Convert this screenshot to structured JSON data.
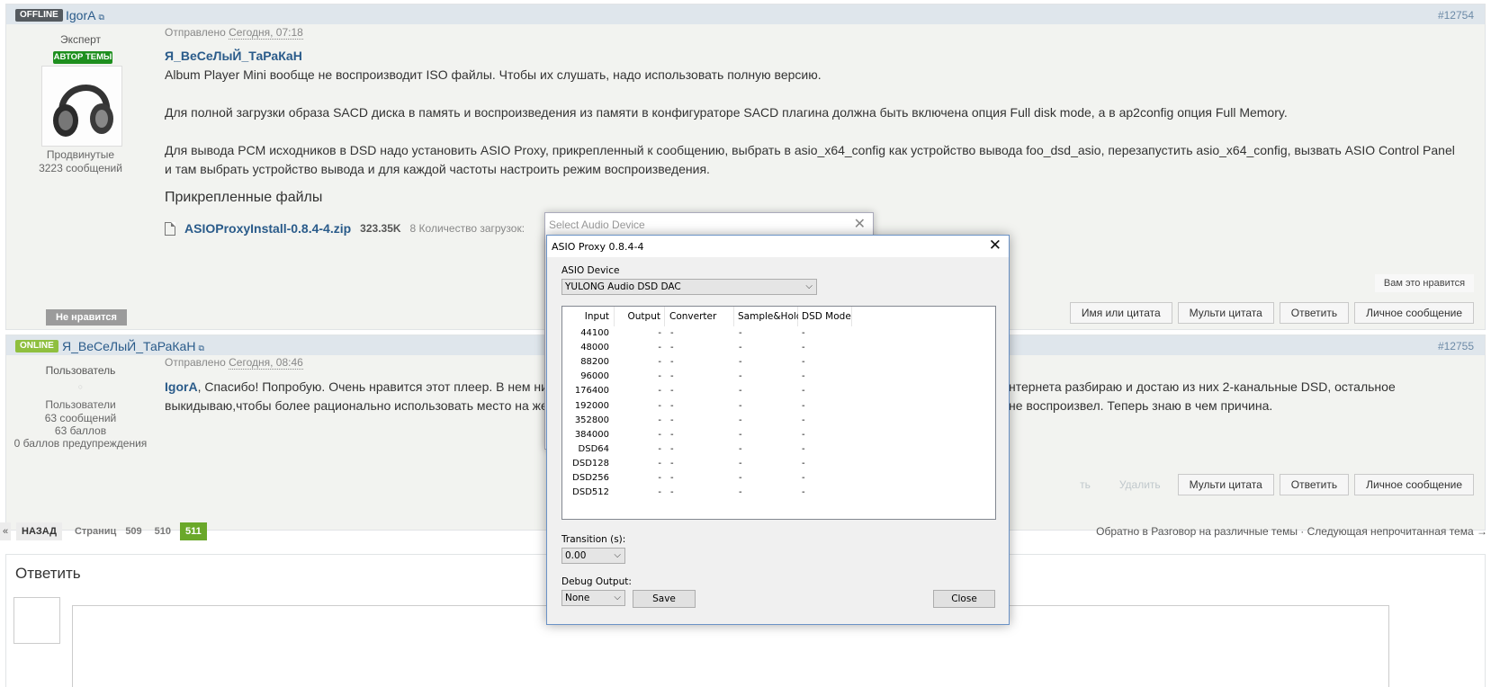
{
  "post1": {
    "status": "OFFLINE",
    "author": "IgorA",
    "number": "#12754",
    "rank": "Эксперт",
    "author_badge": "АВТОР ТЕМЫ",
    "group": "Продвинутые",
    "messages": "3223 сообщений",
    "sent_label": "Отправлено",
    "sent_time": "Сегодня, 07:18",
    "quote_author": "Я_ВеСеЛыЙ_ТаРаКаН",
    "p1": "Album Player Mini вообще не воспроизводит ISO файлы.  Чтобы их слушать, надо использовать полную версию.",
    "p2": "Для полной загрузки образа SACD диска в память и воспроизведения из памяти в конфигураторе SACD плагина должна быть включена опция Full disk mode, а в ap2config опция Full Memory.",
    "p3a": "Для вывода PCM исходников в DSD надо установить ASIO Proxy, прикрепленный к сообщению, выбрать в asio_x64_config как устройство вывода foo_dsd_asio, перезапустить asio_x64_config, вызвать ASIO Control Panel",
    "p3b": "и там выбрать устройство вывода и для каждой частоты настроить режим воспроизведения.",
    "attach_title": "Прикрепленные файлы",
    "file_name": "ASIOProxyInstall-0.8.4-4.zip",
    "file_size": "323.35K",
    "file_downloads": "8 Количество загрузок:",
    "like_text": "Вам это нравится",
    "dislike": "Не нравится",
    "buttons": [
      "Имя или цитата",
      "Мульти цитата",
      "Ответить",
      "Личное сообщение"
    ]
  },
  "post2": {
    "status": "ONLINE",
    "author": "Я_ВеСеЛыЙ_ТаРаКаН",
    "number": "#12755",
    "rank": "Пользователь",
    "group": "Пользователи",
    "messages": "63 сообщений",
    "points": "63 баллов",
    "warnings": "0 баллов предупреждения",
    "sent_label": "Отправлено",
    "sent_time": "Сегодня, 08:46",
    "reply_to": "IgorA",
    "l1_left": ", Спасибо! Попробую. Очень нравится этот плеер. В нем ничего",
    "l1_right": "нтернета разбираю и достаю из них 2-канальные DSD, остальное",
    "l2_left": "выкидываю,чтобы более рационально использовать место на жестк",
    "l2_right": "не воспроизвел. Теперь знаю в чем причина.",
    "muted_buttons": [
      "ть",
      "Удалить"
    ],
    "buttons": [
      "Мульти цитата",
      "Ответить",
      "Личное сообщение"
    ]
  },
  "pager": {
    "prev_arrow": "«",
    "back": "НАЗАД",
    "label": "Страниц",
    "pages": [
      "509",
      "510"
    ],
    "current": "511"
  },
  "nav": "Обратно в Разговор на различные темы · Следующая непрочитанная тема →",
  "reply": {
    "title": "Ответить"
  },
  "dialog_back": {
    "title": "Select Audio Device",
    "close": "✕"
  },
  "dialog": {
    "title": "ASIO Proxy 0.8.4-4",
    "close": "✕",
    "device_label": "ASIO Device",
    "device_value": "YULONG Audio DSD DAC",
    "columns": [
      "Input",
      "Output",
      "Converter",
      "Sample&Hold",
      "DSD Mode"
    ],
    "rows": [
      [
        "44100",
        "-",
        "-",
        "-",
        "-"
      ],
      [
        "48000",
        "-",
        "-",
        "-",
        "-"
      ],
      [
        "88200",
        "-",
        "-",
        "-",
        "-"
      ],
      [
        "96000",
        "-",
        "-",
        "-",
        "-"
      ],
      [
        "176400",
        "-",
        "-",
        "-",
        "-"
      ],
      [
        "192000",
        "-",
        "-",
        "-",
        "-"
      ],
      [
        "352800",
        "-",
        "-",
        "-",
        "-"
      ],
      [
        "384000",
        "-",
        "-",
        "-",
        "-"
      ],
      [
        "DSD64",
        "-",
        "-",
        "-",
        "-"
      ],
      [
        "DSD128",
        "-",
        "-",
        "-",
        "-"
      ],
      [
        "DSD256",
        "-",
        "-",
        "-",
        "-"
      ],
      [
        "DSD512",
        "-",
        "-",
        "-",
        "-"
      ]
    ],
    "transition_label": "Transition (s):",
    "transition_value": "0.00",
    "debug_label": "Debug Output:",
    "debug_value": "None",
    "save": "Save",
    "close_btn": "Close"
  },
  "icons": {
    "dropdown": "chevron-down-icon",
    "file": "file-icon",
    "external": "external-link-icon"
  }
}
